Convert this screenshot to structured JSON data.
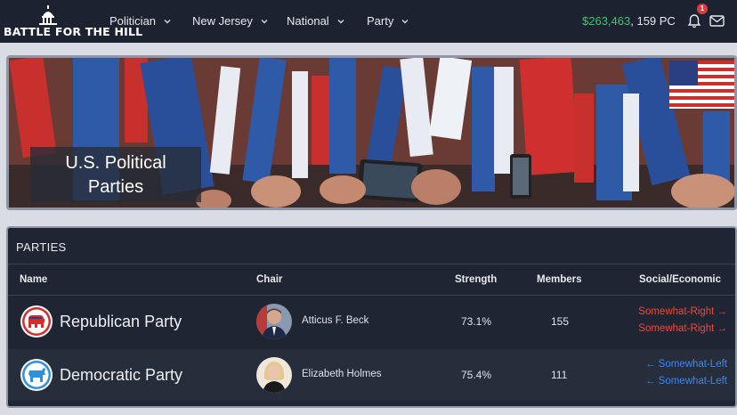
{
  "nav": {
    "logo_text": "BATTLE FOR THE HILL",
    "items": [
      {
        "label": "Politician"
      },
      {
        "label": "New Jersey"
      },
      {
        "label": "National"
      },
      {
        "label": "Party"
      }
    ],
    "cash": "$263,463",
    "pc": ", 159 PC",
    "notification_count": "1"
  },
  "banner": {
    "title_line1": "U.S. Political",
    "title_line2": "Parties"
  },
  "parties": {
    "heading": "PARTIES",
    "columns": {
      "name": "Name",
      "chair": "Chair",
      "strength": "Strength",
      "members": "Members",
      "social_economic": "Social/Economic"
    },
    "rows": [
      {
        "name": "Republican Party",
        "icon": "elephant-icon",
        "color": "#d42d2d",
        "chair": "Atticus F. Beck",
        "strength": "73.1%",
        "members": "155",
        "social": "Somewhat-Right →",
        "economic": "Somewhat-Right →"
      },
      {
        "name": "Democratic Party",
        "icon": "donkey-icon",
        "color": "#2f8fd8",
        "chair": "Elizabeth Holmes",
        "strength": "75.4%",
        "members": "111",
        "social": "← Somewhat-Left",
        "economic": "← Somewhat-Left"
      }
    ]
  },
  "colors": {
    "nav_bg": "#1c2230",
    "panel_bg": "#1f2532",
    "cash_green": "#3ec46d",
    "right_red": "#f0483e",
    "left_blue": "#3f86f0"
  }
}
